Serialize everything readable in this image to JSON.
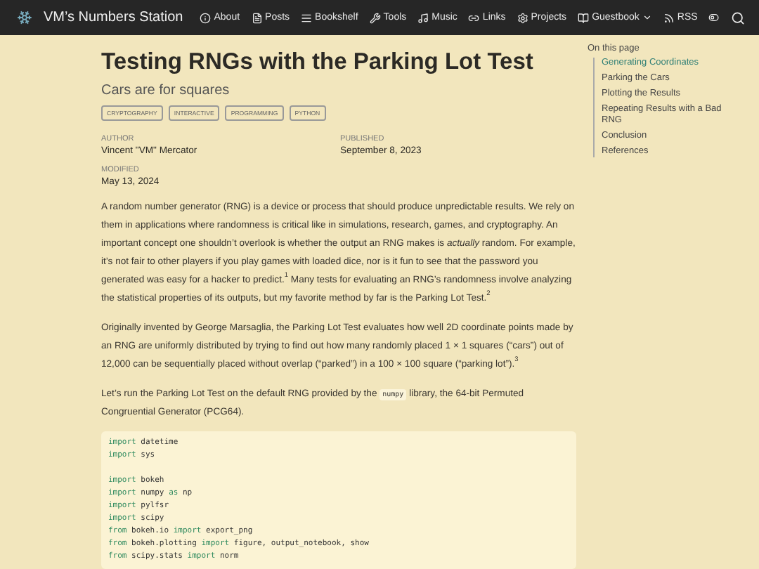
{
  "site": {
    "title": "VM’s Numbers Station"
  },
  "nav": [
    {
      "label": "About",
      "kind": "info"
    },
    {
      "label": "Posts",
      "kind": "posts"
    },
    {
      "label": "Bookshelf",
      "kind": "books"
    },
    {
      "label": "Tools",
      "kind": "tools"
    },
    {
      "label": "Music",
      "kind": "music"
    },
    {
      "label": "Links",
      "kind": "links"
    },
    {
      "label": "Projects",
      "kind": "projects"
    },
    {
      "label": "Guestbook",
      "kind": "guestbook",
      "dropdown": true
    },
    {
      "label": "RSS",
      "kind": "rss"
    }
  ],
  "article": {
    "title": "Testing RNGs with the Parking Lot Test",
    "subtitle": "Cars are for squares",
    "tags": [
      "CRYPTOGRAPHY",
      "INTERACTIVE",
      "PROGRAMMING",
      "PYTHON"
    ],
    "meta": [
      {
        "label": "AUTHOR",
        "value": "Vincent \"VM\" Mercator"
      },
      {
        "label": "PUBLISHED",
        "value": "September 8, 2023"
      },
      {
        "label": "MODIFIED",
        "value": "May 13, 2024"
      }
    ],
    "paragraphs": [
      "A random number generator (RNG) is a device or process that should produce unpredictable results. We rely on them in applications where randomness is critical like in simulations, research, games, and cryptography. An important concept one shouldn’t overlook is whether the output an RNG makes is *actually* random. For example, it’s not fair to other players if you play games with loaded dice, nor is it fun to see that the password you generated was easy for a hacker to predict.$^{1}$ Many tests for evaluating an RNG’s randomness involve analyzing the statistical properties of its outputs, but my favorite method by far is the Parking Lot Test.$^{2}$",
      "Originally invented by George Marsaglia, the Parking Lot Test evaluates how well 2D coordinate points made by an RNG are uniformly distributed by trying to find out how many randomly placed 1 × 1 squares (“cars”) out of 12,000 can be sequentially placed without overlap (“parked”) in a 100 × 100 square (“parking lot”).$^{3}$"
    ],
    "intro": {
      "before": "Let’s run the Parking Lot Test on the default RNG provided by the",
      "code": "numpy",
      "after": "library, the 64-bit Permuted Congruential Generator (PCG64)."
    },
    "code": [
      {
        "kind": "code",
        "segments": [
          {
            "kind": "keyword",
            "text": "import"
          },
          {
            "kind": "plain",
            "text": " datetime"
          }
        ]
      },
      {
        "kind": "code",
        "segments": [
          {
            "kind": "keyword",
            "text": "import"
          },
          {
            "kind": "plain",
            "text": " sys"
          }
        ]
      },
      {
        "kind": "blank"
      },
      {
        "kind": "code",
        "segments": [
          {
            "kind": "keyword",
            "text": "import"
          },
          {
            "kind": "plain",
            "text": " bokeh"
          }
        ]
      },
      {
        "kind": "code",
        "segments": [
          {
            "kind": "keyword",
            "text": "import"
          },
          {
            "kind": "plain",
            "text": " numpy "
          },
          {
            "kind": "keyword",
            "text": "as"
          },
          {
            "kind": "plain",
            "text": " np"
          }
        ]
      },
      {
        "kind": "code",
        "segments": [
          {
            "kind": "keyword",
            "text": "import"
          },
          {
            "kind": "plain",
            "text": " pylfsr"
          }
        ]
      },
      {
        "kind": "code",
        "segments": [
          {
            "kind": "keyword",
            "text": "import"
          },
          {
            "kind": "plain",
            "text": " scipy"
          }
        ]
      },
      {
        "kind": "code",
        "segments": [
          {
            "kind": "keyword",
            "text": "from"
          },
          {
            "kind": "plain",
            "text": " bokeh.io "
          },
          {
            "kind": "keyword",
            "text": "import"
          },
          {
            "kind": "plain",
            "text": " export_png"
          }
        ]
      },
      {
        "kind": "code",
        "segments": [
          {
            "kind": "keyword",
            "text": "from"
          },
          {
            "kind": "plain",
            "text": " bokeh.plotting "
          },
          {
            "kind": "keyword",
            "text": "import"
          },
          {
            "kind": "plain",
            "text": " figure, output_notebook, show"
          }
        ]
      },
      {
        "kind": "code",
        "segments": [
          {
            "kind": "keyword",
            "text": "from"
          },
          {
            "kind": "plain",
            "text": " scipy.stats "
          },
          {
            "kind": "keyword",
            "text": "import"
          },
          {
            "kind": "plain",
            "text": " norm"
          }
        ]
      }
    ]
  },
  "toc": {
    "heading": "On this page",
    "items": [
      {
        "label": "Generating Coordinates",
        "selected": true
      },
      {
        "label": "Parking the Cars",
        "selected": false
      },
      {
        "label": "Plotting the Results",
        "selected": false
      },
      {
        "label": "Repeating Results with a Bad RNG",
        "selected": false
      },
      {
        "label": "Conclusion",
        "selected": false
      },
      {
        "label": "References",
        "selected": false
      }
    ]
  }
}
